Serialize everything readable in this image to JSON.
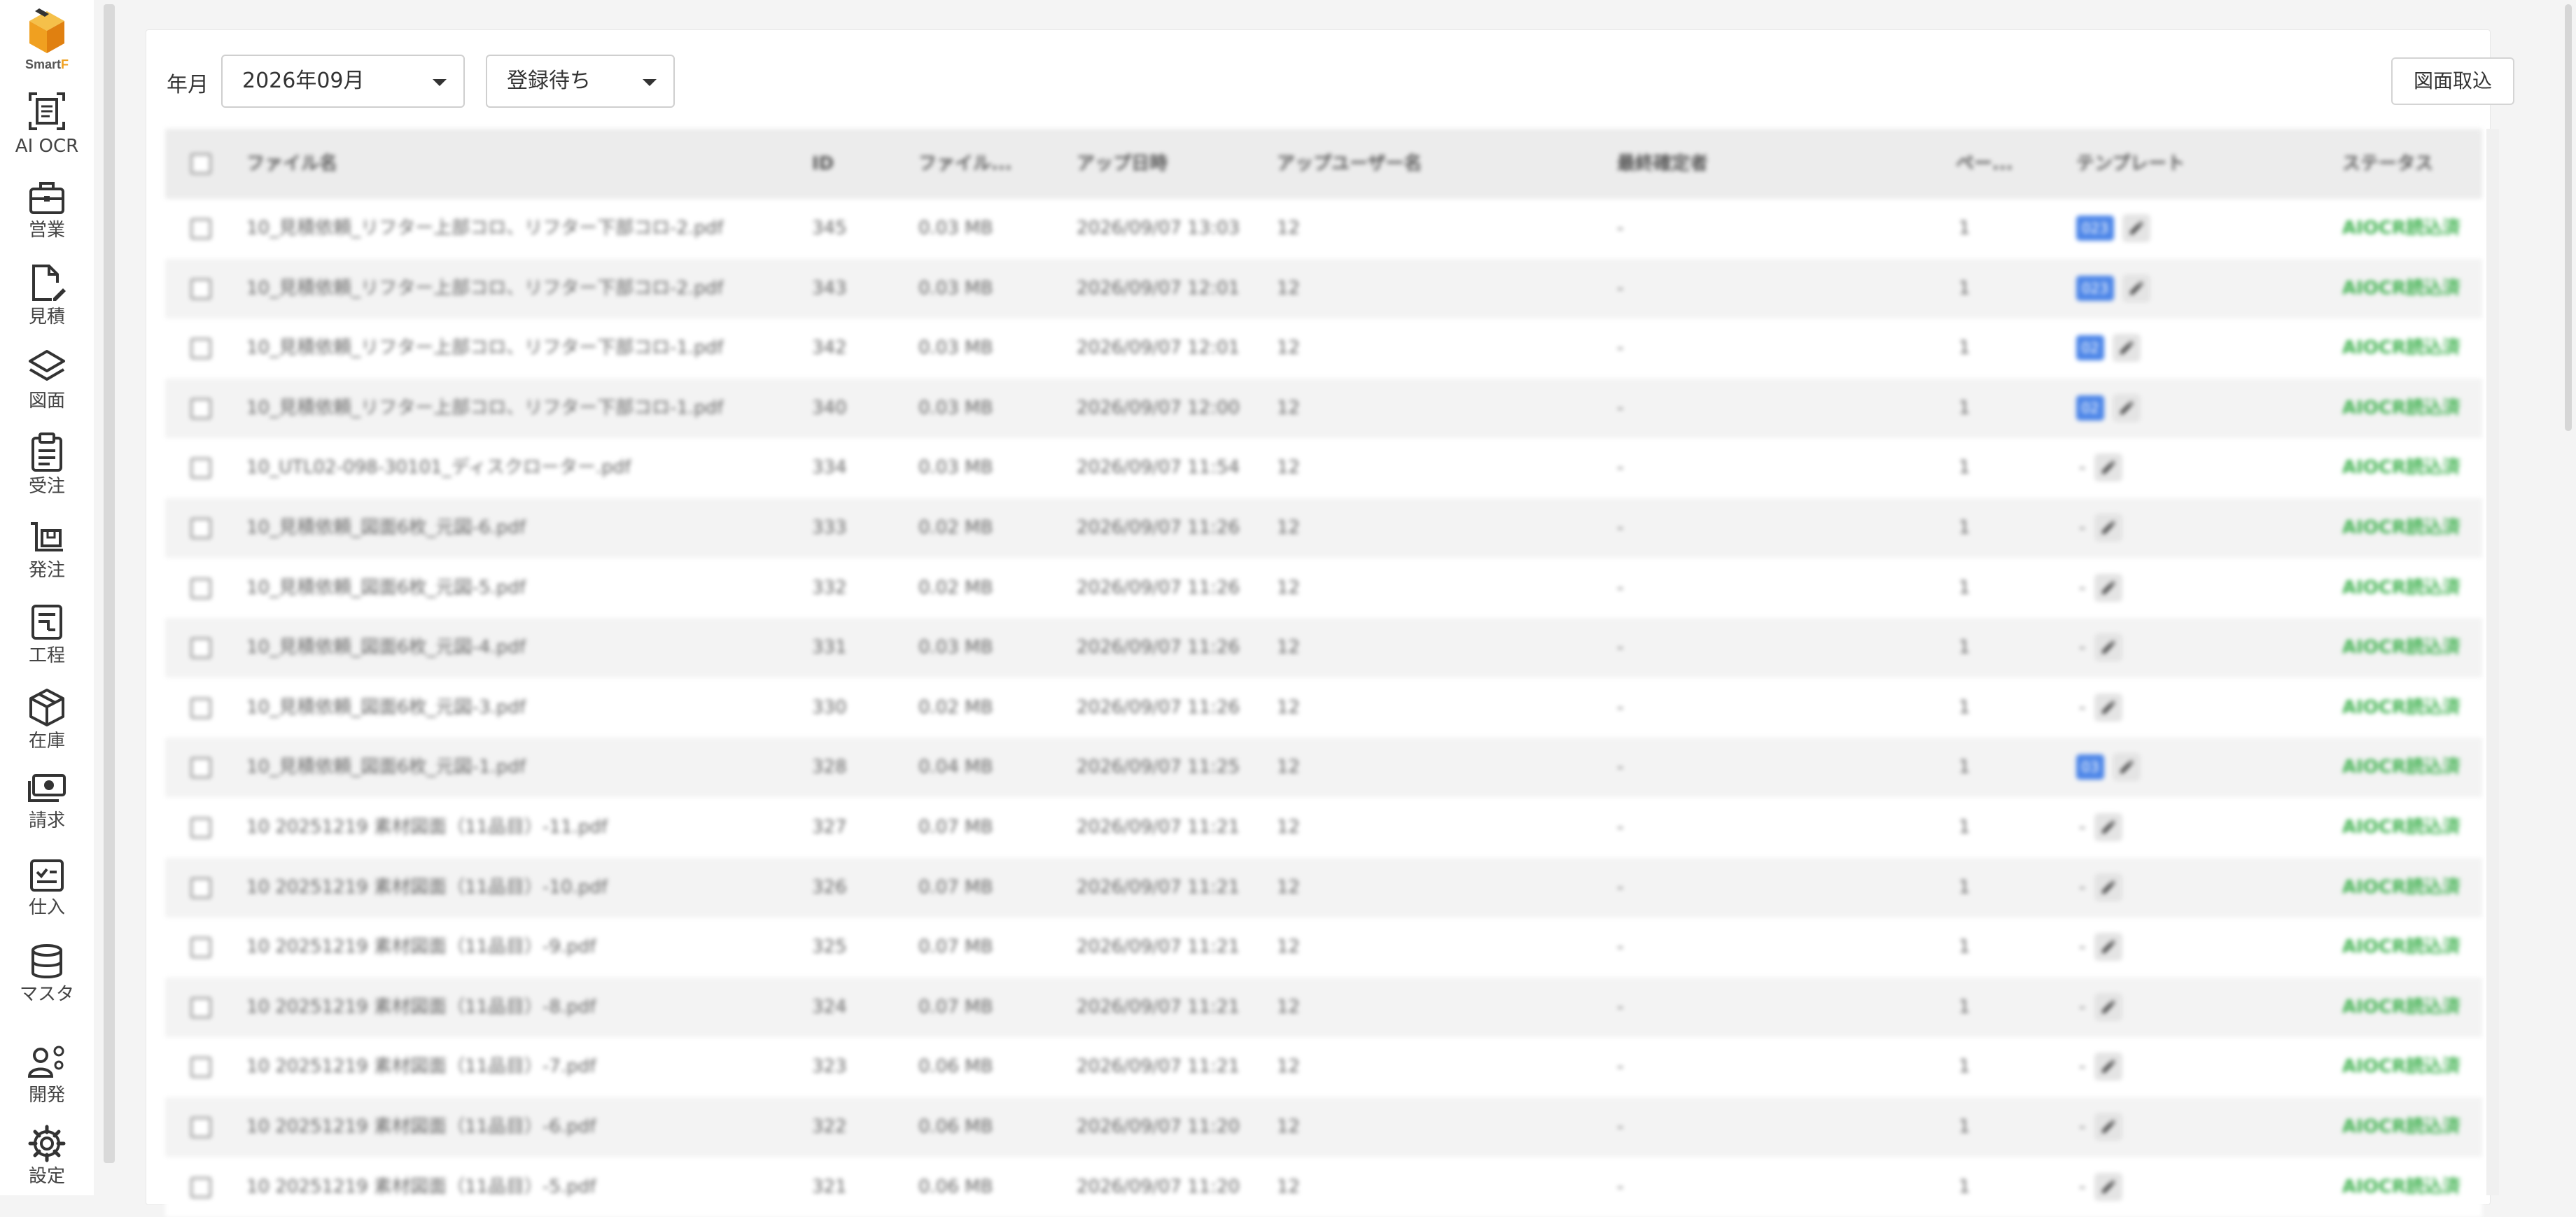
{
  "sidebar": {
    "logo_text_main": "Smart",
    "logo_text_accent": "F",
    "items": [
      {
        "label": "AI OCR",
        "icon": "ocr-scan-icon"
      },
      {
        "label": "営業",
        "icon": "briefcase-icon"
      },
      {
        "label": "見積",
        "icon": "document-edit-icon"
      },
      {
        "label": "図面",
        "icon": "layers-icon"
      },
      {
        "label": "受注",
        "icon": "clipboard-icon"
      },
      {
        "label": "発注",
        "icon": "cart-icon"
      },
      {
        "label": "工程",
        "icon": "process-icon"
      },
      {
        "label": "在庫",
        "icon": "box-icon"
      },
      {
        "label": "請求",
        "icon": "cash-icon"
      },
      {
        "label": "仕入",
        "icon": "checklist-icon"
      },
      {
        "label": "マスタ",
        "icon": "database-icon"
      },
      {
        "label": "開発",
        "icon": "developer-icon"
      },
      {
        "label": "設定",
        "icon": "gear-icon"
      }
    ]
  },
  "filters": {
    "label": "年月",
    "month_value": "2026年09月",
    "status_value": "登録待ち"
  },
  "actions": {
    "import_label": "図面取込"
  },
  "table": {
    "columns": [
      "ファイル名",
      "ID",
      "ファイル...",
      "アップ日時",
      "アップユーザー名",
      "最終確定者",
      "ペー...",
      "テンプレート",
      "ステータス"
    ],
    "rows": [
      {
        "file": "10_見積依頼_リフター上部コロ、リフター下部コロ-2.pdf",
        "id": "345",
        "size": "0.03 MB",
        "date": "2026/09/07 13:03",
        "user": "12",
        "confirmer": "-",
        "pages": "1",
        "template": "023",
        "status": "AIOCR読込済"
      },
      {
        "file": "10_見積依頼_リフター上部コロ、リフター下部コロ-2.pdf",
        "id": "343",
        "size": "0.03 MB",
        "date": "2026/09/07 12:01",
        "user": "12",
        "confirmer": "-",
        "pages": "1",
        "template": "023",
        "status": "AIOCR読込済"
      },
      {
        "file": "10_見積依頼_リフター上部コロ、リフター下部コロ-1.pdf",
        "id": "342",
        "size": "0.03 MB",
        "date": "2026/09/07 12:01",
        "user": "12",
        "confirmer": "-",
        "pages": "1",
        "template": "02",
        "status": "AIOCR読込済"
      },
      {
        "file": "10_見積依頼_リフター上部コロ、リフター下部コロ-1.pdf",
        "id": "340",
        "size": "0.03 MB",
        "date": "2026/09/07 12:00",
        "user": "12",
        "confirmer": "-",
        "pages": "1",
        "template": "02",
        "status": "AIOCR読込済"
      },
      {
        "file": "10_UTL02-098-30101_ディスクローター.pdf",
        "id": "334",
        "size": "0.03 MB",
        "date": "2026/09/07 11:54",
        "user": "12",
        "confirmer": "-",
        "pages": "1",
        "template": "",
        "status": "AIOCR読込済"
      },
      {
        "file": "10_見積依頼_図面6枚_元図-6.pdf",
        "id": "333",
        "size": "0.02 MB",
        "date": "2026/09/07 11:26",
        "user": "12",
        "confirmer": "-",
        "pages": "1",
        "template": "",
        "status": "AIOCR読込済"
      },
      {
        "file": "10_見積依頼_図面6枚_元図-5.pdf",
        "id": "332",
        "size": "0.02 MB",
        "date": "2026/09/07 11:26",
        "user": "12",
        "confirmer": "-",
        "pages": "1",
        "template": "",
        "status": "AIOCR読込済"
      },
      {
        "file": "10_見積依頼_図面6枚_元図-4.pdf",
        "id": "331",
        "size": "0.03 MB",
        "date": "2026/09/07 11:26",
        "user": "12",
        "confirmer": "-",
        "pages": "1",
        "template": "",
        "status": "AIOCR読込済"
      },
      {
        "file": "10_見積依頼_図面6枚_元図-3.pdf",
        "id": "330",
        "size": "0.02 MB",
        "date": "2026/09/07 11:26",
        "user": "12",
        "confirmer": "-",
        "pages": "1",
        "template": "",
        "status": "AIOCR読込済"
      },
      {
        "file": "10_見積依頼_図面6枚_元図-1.pdf",
        "id": "328",
        "size": "0.04 MB",
        "date": "2026/09/07 11:25",
        "user": "12",
        "confirmer": "-",
        "pages": "1",
        "template": "03",
        "status": "AIOCR読込済"
      },
      {
        "file": "10 20251219 素材図面（11品目）-11.pdf",
        "id": "327",
        "size": "0.07 MB",
        "date": "2026/09/07 11:21",
        "user": "12",
        "confirmer": "-",
        "pages": "1",
        "template": "",
        "status": "AIOCR読込済"
      },
      {
        "file": "10 20251219 素材図面（11品目）-10.pdf",
        "id": "326",
        "size": "0.07 MB",
        "date": "2026/09/07 11:21",
        "user": "12",
        "confirmer": "-",
        "pages": "1",
        "template": "",
        "status": "AIOCR読込済"
      },
      {
        "file": "10 20251219 素材図面（11品目）-9.pdf",
        "id": "325",
        "size": "0.07 MB",
        "date": "2026/09/07 11:21",
        "user": "12",
        "confirmer": "-",
        "pages": "1",
        "template": "",
        "status": "AIOCR読込済"
      },
      {
        "file": "10 20251219 素材図面（11品目）-8.pdf",
        "id": "324",
        "size": "0.07 MB",
        "date": "2026/09/07 11:21",
        "user": "12",
        "confirmer": "-",
        "pages": "1",
        "template": "",
        "status": "AIOCR読込済"
      },
      {
        "file": "10 20251219 素材図面（11品目）-7.pdf",
        "id": "323",
        "size": "0.06 MB",
        "date": "2026/09/07 11:21",
        "user": "12",
        "confirmer": "-",
        "pages": "1",
        "template": "",
        "status": "AIOCR読込済"
      },
      {
        "file": "10 20251219 素材図面（11品目）-6.pdf",
        "id": "322",
        "size": "0.06 MB",
        "date": "2026/09/07 11:20",
        "user": "12",
        "confirmer": "-",
        "pages": "1",
        "template": "",
        "status": "AIOCR読込済"
      },
      {
        "file": "10 20251219 素材図面（11品目）-5.pdf",
        "id": "321",
        "size": "0.06 MB",
        "date": "2026/09/07 11:20",
        "user": "12",
        "confirmer": "-",
        "pages": "1",
        "template": "",
        "status": "AIOCR読込済"
      }
    ]
  },
  "colors": {
    "status_green": "#3fb24f",
    "template_blue": "#4d86e8",
    "logo_orange": "#f0a020"
  }
}
